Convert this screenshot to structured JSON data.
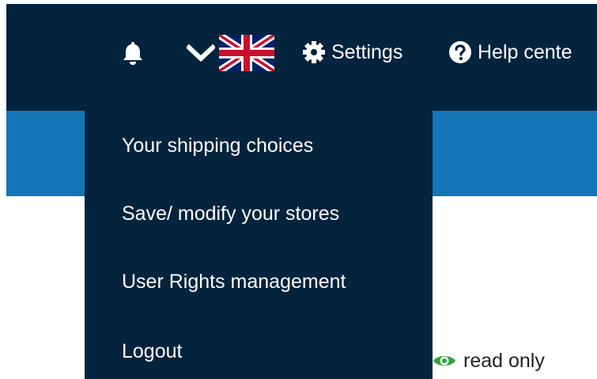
{
  "header": {
    "icons": {
      "notifications": "bell-icon",
      "language_dropdown": "chevron-down-icon",
      "language_flag": "uk-flag-icon",
      "settings": "gear-icon",
      "help": "question-circle-icon"
    },
    "settings_label": "Settings",
    "help_label": "Help cente"
  },
  "dropdown": {
    "items": [
      {
        "label": "Your shipping choices"
      },
      {
        "label": "Save/ modify your stores"
      },
      {
        "label": "User Rights management"
      },
      {
        "label": "Logout"
      }
    ]
  },
  "status": {
    "icon": "eye-icon",
    "label": "read only"
  },
  "colors": {
    "navbar": "#04233d",
    "accent_bar": "#1576b7",
    "text_on_dark": "#ffffff",
    "eye_icon": "#2ea43a"
  }
}
